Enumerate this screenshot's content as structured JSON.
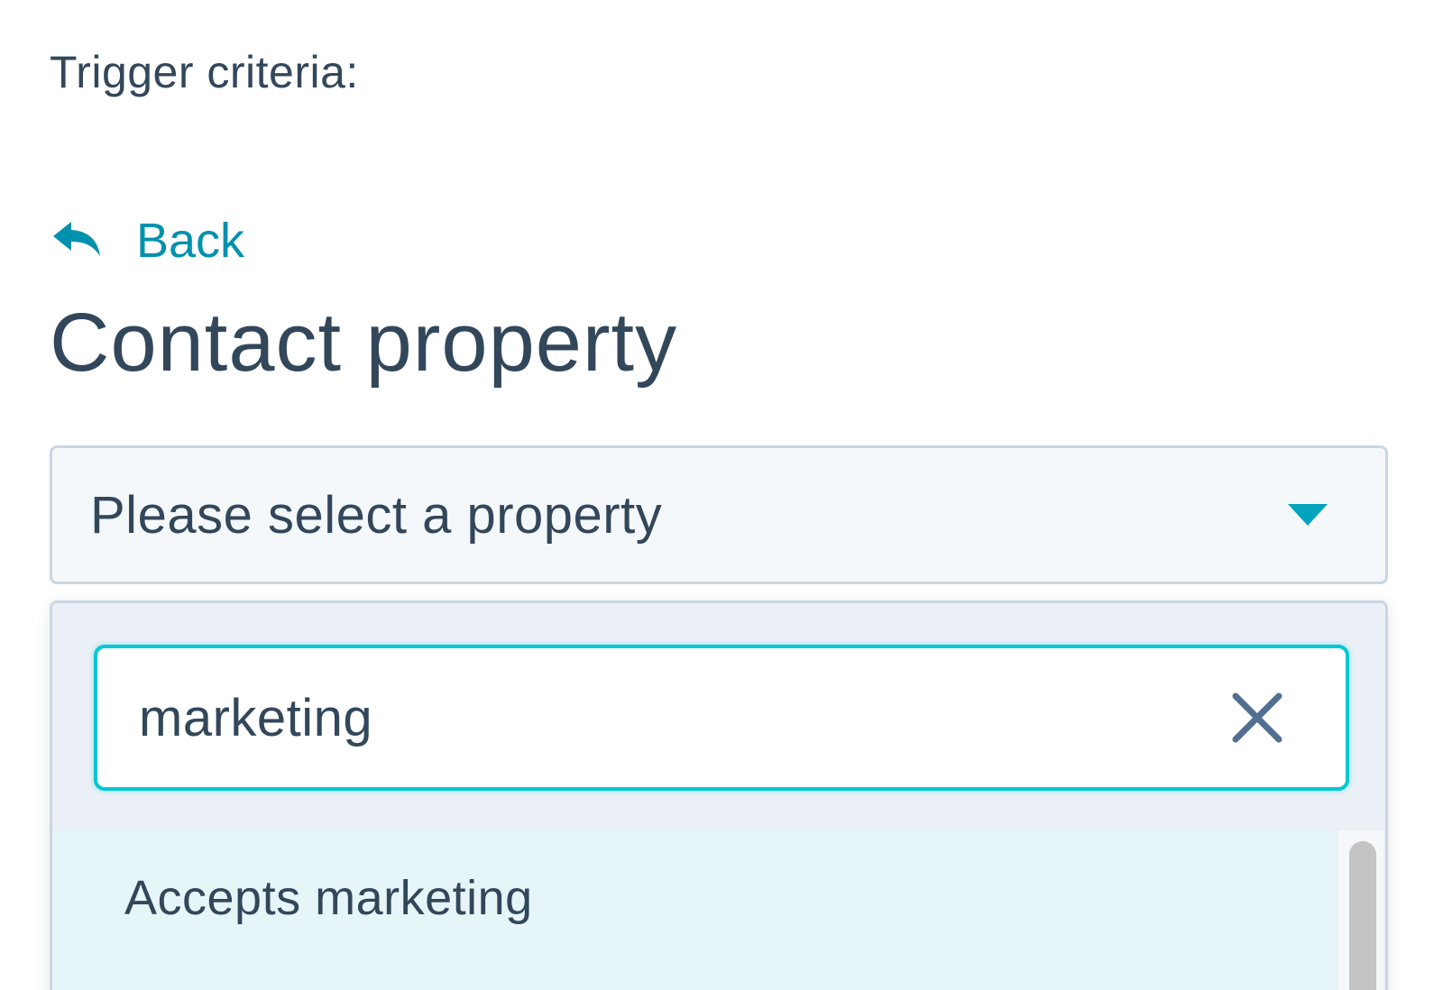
{
  "trigger": {
    "label": "Trigger criteria:"
  },
  "back": {
    "icon": "reply-arrow-icon",
    "label": "Back"
  },
  "section": {
    "title": "Contact property"
  },
  "property_select": {
    "placeholder": "Please select a property",
    "icon": "caret-down-icon"
  },
  "search": {
    "value": "marketing",
    "clear_icon": "close-icon"
  },
  "results": {
    "items": [
      {
        "label": "Accepts marketing"
      }
    ]
  },
  "colors": {
    "accent": "#0091ae",
    "text": "#33475b",
    "focus_border": "#00c8d4",
    "highlight": "#e5f5f8",
    "panel": "#eaf0f6"
  }
}
